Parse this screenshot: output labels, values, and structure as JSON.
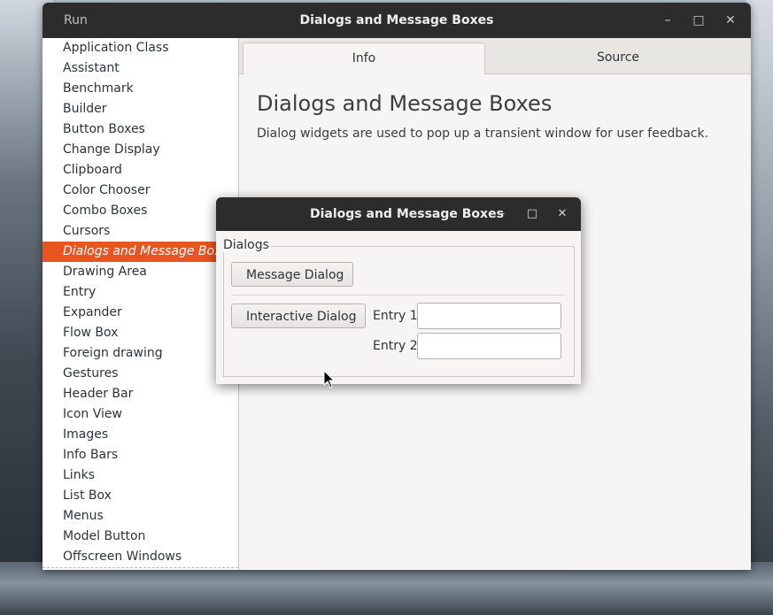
{
  "main_window": {
    "title": "Dialogs and Message Boxes",
    "run_label": "Run",
    "controls": {
      "minimize": "–",
      "maximize": "□",
      "close": "✕"
    }
  },
  "sidebar": {
    "items": [
      "Application Class",
      "Assistant",
      "Benchmark",
      "Builder",
      "Button Boxes",
      "Change Display",
      "Clipboard",
      "Color Chooser",
      "Combo Boxes",
      "Cursors",
      "Dialogs and Message Boxes",
      "Drawing Area",
      "Entry",
      "Expander",
      "Flow Box",
      "Foreign drawing",
      "Gestures",
      "Header Bar",
      "Icon View",
      "Images",
      "Info Bars",
      "Links",
      "List Box",
      "Menus",
      "Model Button",
      "Offscreen Windows"
    ],
    "selected_index": 10
  },
  "tabs": [
    "Info",
    "Source"
  ],
  "info": {
    "heading": "Dialogs and Message Boxes",
    "description": "Dialog widgets are used to pop up a transient window for user feedback."
  },
  "dialog": {
    "title": "Dialogs and Message Boxes",
    "frame_label": "Dialogs",
    "message_button": "Message Dialog",
    "interactive_button": "Interactive Dialog",
    "entry1_label": "Entry 1",
    "entry2_label": "Entry 2",
    "entry1_value": "",
    "entry2_value": ""
  },
  "colors": {
    "accent": "#e95420",
    "titlebar": "#2c2c2c"
  }
}
